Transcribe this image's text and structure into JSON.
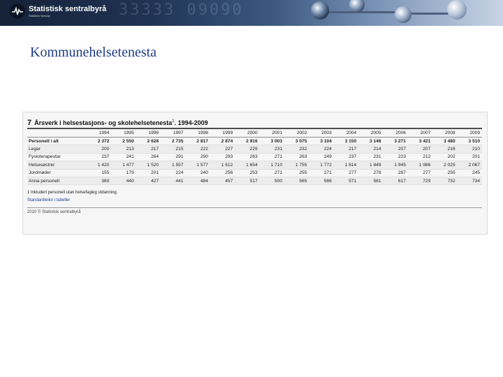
{
  "header": {
    "logo_name": "Statistisk sentralbyrå",
    "logo_sub": "Statistics Norway",
    "background_digits": "33333 09090",
    "colors": {
      "banner_dark": "#152238",
      "banner_light": "#c9d5e6"
    }
  },
  "page": {
    "title": "Kommunehelsetenesta",
    "title_color": "#1f3c86"
  },
  "table": {
    "number": "7",
    "title": "Årsverk i helsestasjons- og skolehelsetenesta",
    "title_note": "1",
    "title_years": ". 1994-2009",
    "columns": [
      "",
      "1994",
      "1995",
      "1996",
      "1997",
      "1998",
      "1999",
      "2000",
      "2001",
      "2002",
      "2003",
      "2004",
      "2005",
      "2006",
      "2007",
      "2008",
      "2009"
    ],
    "rows": [
      {
        "label": "Personell i alt",
        "bold": true,
        "values": [
          "2 372",
          "2 550",
          "2 628",
          "2 735",
          "2 817",
          "2 874",
          "2 916",
          "3 003",
          "3 075",
          "3 104",
          "3 150",
          "3 146",
          "3 271",
          "3 421",
          "3 480",
          "3 510"
        ]
      },
      {
        "label": "Legar",
        "bold": false,
        "values": [
          "200",
          "213",
          "217",
          "215",
          "222",
          "227",
          "229",
          "231",
          "232",
          "224",
          "217",
          "214",
          "207",
          "207",
          "216",
          "210"
        ]
      },
      {
        "label": "Fysioterapeutar",
        "bold": false,
        "values": [
          "237",
          "241",
          "264",
          "291",
          "290",
          "293",
          "263",
          "271",
          "263",
          "249",
          "237",
          "231",
          "223",
          "212",
          "202",
          "201"
        ]
      },
      {
        "label": "Helsesøstrer",
        "bold": false,
        "values": [
          "1 420",
          "1 477",
          "1 520",
          "1 557",
          "1 577",
          "1 612",
          "1 654",
          "1 710",
          "1 755",
          "1 772",
          "1 814",
          "1 849",
          "1 945",
          "1 986",
          "2 025",
          "2 067"
        ]
      },
      {
        "label": "Jordmøder",
        "bold": false,
        "values": [
          "155",
          "179",
          "201",
          "224",
          "240",
          "256",
          "253",
          "271",
          "255",
          "271",
          "277",
          "278",
          "287",
          "277",
          "255",
          "245"
        ]
      },
      {
        "label": "Anna personell",
        "bold": false,
        "values": [
          "360",
          "440",
          "427",
          "441",
          "484",
          "457",
          "517",
          "500",
          "565",
          "586",
          "571",
          "581",
          "617",
          "729",
          "732",
          "734"
        ]
      }
    ],
    "footnote": "1  Inkludert personell utan helsefagleg utdanning.",
    "link_text": "Standardteikn i tabeller",
    "copyright": "2010 © Statistisk sentralbyrå"
  }
}
